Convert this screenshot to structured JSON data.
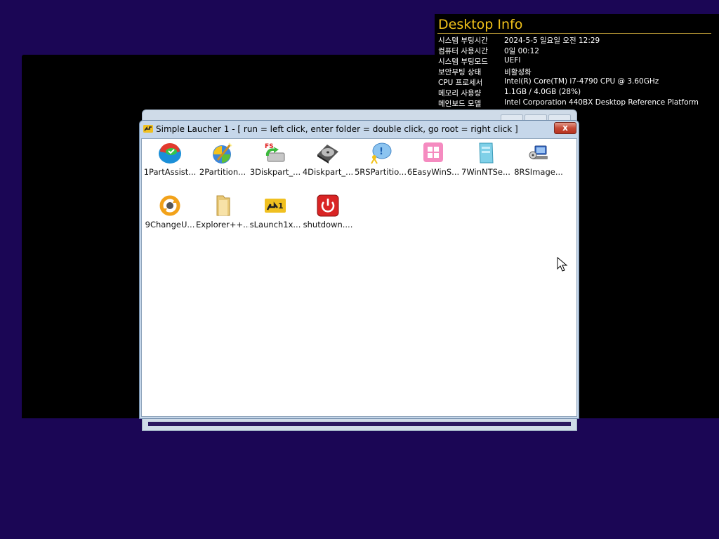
{
  "desktop_info": {
    "title": "Desktop Info",
    "rows": [
      {
        "key": "시스템 부팅시간",
        "value": "2024-5-5 일요일 오전 12:29"
      },
      {
        "key": "컴퓨터 사용시간",
        "value": "0일 00:12"
      },
      {
        "key": "시스템 부팅모드",
        "value": "UEFI"
      },
      {
        "key": "보안부팅 상태",
        "value": "비활성화"
      },
      {
        "key": "CPU 프로세서",
        "value": "Intel(R) Core(TM) i7-4790 CPU @ 3.60GHz"
      },
      {
        "key": "메모리 사용량",
        "value": "1.1GB / 4.0GB (28%)"
      },
      {
        "key": "메인보드 모델",
        "value": "Intel Corporation 440BX Desktop Reference Platform"
      }
    ]
  },
  "window": {
    "title": "Simple Laucher 1 - [ run = left click, enter folder = double click, go root = right click ]",
    "close_label": "x"
  },
  "icons": [
    {
      "label": "1PartAssist...",
      "icon": "part-assist-icon"
    },
    {
      "label": "2Partition...",
      "icon": "partition-wizard-icon"
    },
    {
      "label": "3Diskpart_...",
      "icon": "diskpart-fs-icon"
    },
    {
      "label": "4Diskpart_...",
      "icon": "hard-disk-icon"
    },
    {
      "label": "5RSPartitio...",
      "icon": "rs-partition-icon"
    },
    {
      "label": "6EasyWinS...",
      "icon": "easy-win-setup-icon"
    },
    {
      "label": "7WinNTSe...",
      "icon": "winntsetup-icon"
    },
    {
      "label": "8RSImage...",
      "icon": "rs-image-icon"
    },
    {
      "label": "9ChangeU...",
      "icon": "change-uefi-icon"
    },
    {
      "label": "Explorer++...",
      "icon": "folder-icon"
    },
    {
      "label": "sLaunch1x...",
      "icon": "slaunch-icon"
    },
    {
      "label": "shutdown....",
      "icon": "power-icon"
    }
  ],
  "colors": {
    "desktop_bg": "#1b0655",
    "info_title": "#f2c21a",
    "window_frame": "#c6d7ea"
  }
}
